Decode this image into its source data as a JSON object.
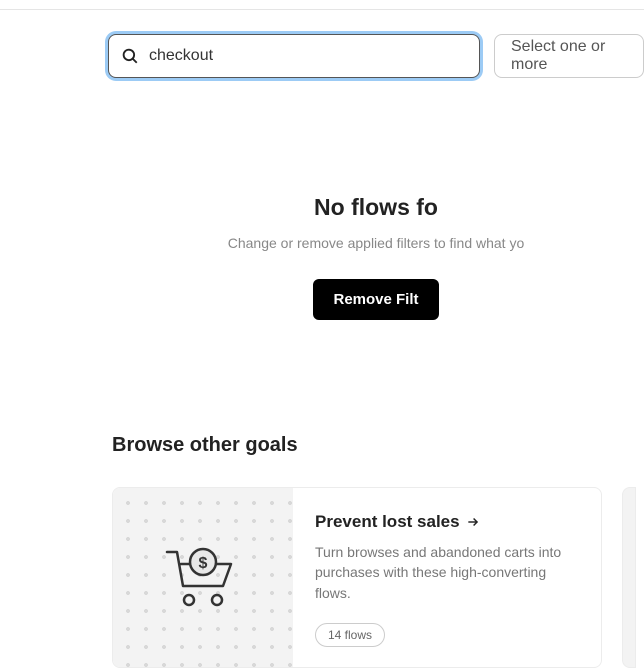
{
  "search": {
    "value": "checkout",
    "placeholder": ""
  },
  "filter_select": {
    "placeholder": "Select one or more"
  },
  "empty_state": {
    "title": "No flows fo",
    "subtitle": "Change or remove applied filters to find what yo",
    "remove_button": "Remove Filt"
  },
  "browse": {
    "heading": "Browse other goals",
    "goals": [
      {
        "title": "Prevent lost sales",
        "description": "Turn browses and abandoned carts into purchases with these high-converting flows.",
        "badge": "14 flows"
      }
    ]
  }
}
